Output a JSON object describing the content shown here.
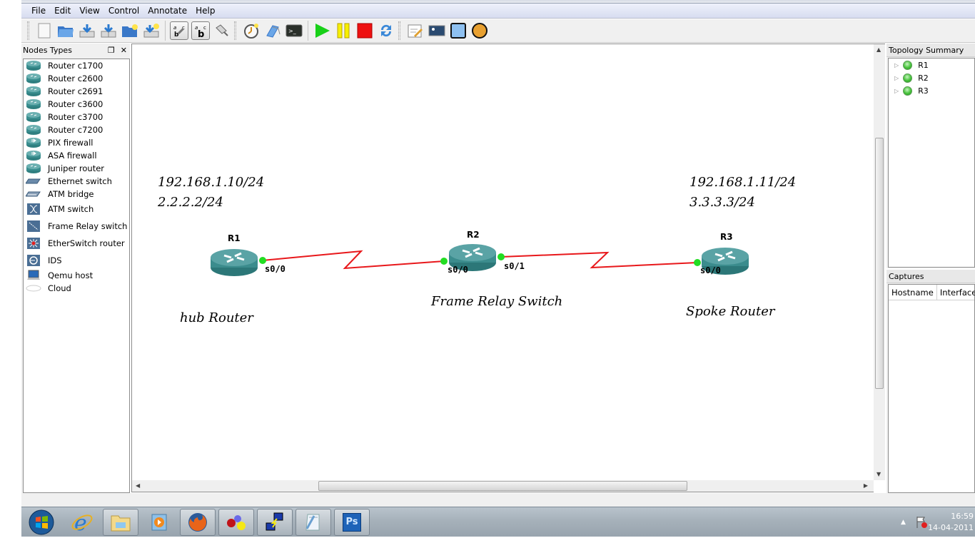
{
  "menu": [
    "File",
    "Edit",
    "View",
    "Control",
    "Annotate",
    "Help"
  ],
  "toolbar": {
    "buttons": [
      {
        "name": "new-topology-icon"
      },
      {
        "name": "open-folder-icon"
      },
      {
        "name": "save-icon"
      },
      {
        "name": "save-as-icon"
      },
      {
        "name": "open-project-icon"
      },
      {
        "name": "save-project-icon"
      },
      {
        "name": "show-interface-labels-icon",
        "toggled": true
      },
      {
        "name": "show-hostnames-icon",
        "toggled": true
      },
      {
        "name": "add-link-icon"
      },
      {
        "name": "snapshot-icon"
      },
      {
        "name": "idle-pc-icon"
      },
      {
        "name": "console-icon"
      },
      {
        "name": "start-icon"
      },
      {
        "name": "suspend-icon"
      },
      {
        "name": "stop-icon"
      },
      {
        "name": "reload-icon"
      },
      {
        "name": "add-note-icon"
      },
      {
        "name": "insert-picture-icon"
      },
      {
        "name": "draw-rectangle-icon"
      },
      {
        "name": "draw-ellipse-icon"
      }
    ]
  },
  "nodes_dock": {
    "title": "Nodes Types",
    "items": [
      {
        "label": "Router c1700",
        "icon": "router"
      },
      {
        "label": "Router c2600",
        "icon": "router"
      },
      {
        "label": "Router c2691",
        "icon": "router"
      },
      {
        "label": "Router c3600",
        "icon": "router"
      },
      {
        "label": "Router c3700",
        "icon": "router"
      },
      {
        "label": "Router c7200",
        "icon": "router"
      },
      {
        "label": "PIX firewall",
        "icon": "firewall"
      },
      {
        "label": "ASA firewall",
        "icon": "firewall"
      },
      {
        "label": "Juniper router",
        "icon": "router"
      },
      {
        "label": "Ethernet switch",
        "icon": "ethernet-switch"
      },
      {
        "label": "ATM bridge",
        "icon": "atm-bridge"
      },
      {
        "label": "ATM switch",
        "icon": "atm-switch"
      },
      {
        "label": "Frame Relay switch",
        "icon": "frame-relay-switch"
      },
      {
        "label": "EtherSwitch router",
        "icon": "etherswitch-router"
      },
      {
        "label": "IDS",
        "icon": "ids"
      },
      {
        "label": "Qemu host",
        "icon": "qemu-host"
      },
      {
        "label": "Cloud",
        "icon": "cloud"
      }
    ]
  },
  "topology": {
    "routers": [
      {
        "name": "R1",
        "interfaces": [
          "s0/0"
        ]
      },
      {
        "name": "R2",
        "interfaces": [
          "s0/0",
          "s0/1"
        ]
      },
      {
        "name": "R3",
        "interfaces": [
          "s0/0"
        ]
      }
    ],
    "links": [
      {
        "from": "R1 s0/0",
        "to": "R2 s0/0",
        "color": "#e8181b"
      },
      {
        "from": "R2 s0/1",
        "to": "R3 s0/0",
        "color": "#e8181b"
      }
    ],
    "status_color": "#22dd22",
    "notes": {
      "r1_ip1": "192.168.1.10/24",
      "r1_ip2": "2.2.2.2/24",
      "r3_ip1": "192.168.1.11/24",
      "r3_ip2": "3.3.3.3/24",
      "r1_caption": "hub Router",
      "r2_caption": "Frame Relay Switch",
      "r3_caption": "Spoke Router"
    }
  },
  "topology_summary": {
    "title": "Topology Summary",
    "items": [
      {
        "label": "R1",
        "status": "running"
      },
      {
        "label": "R2",
        "status": "running"
      },
      {
        "label": "R3",
        "status": "running"
      }
    ]
  },
  "captures": {
    "title": "Captures",
    "columns": [
      "Hostname",
      "Interface"
    ]
  },
  "taskbar": {
    "apps": [
      "internet-explorer",
      "windows-explorer",
      "media-player",
      "firefox",
      "gns3",
      "putty",
      "notepad",
      "photoshop"
    ],
    "ps_label": "Ps",
    "time": "16:59",
    "date": "14-04-2011"
  }
}
